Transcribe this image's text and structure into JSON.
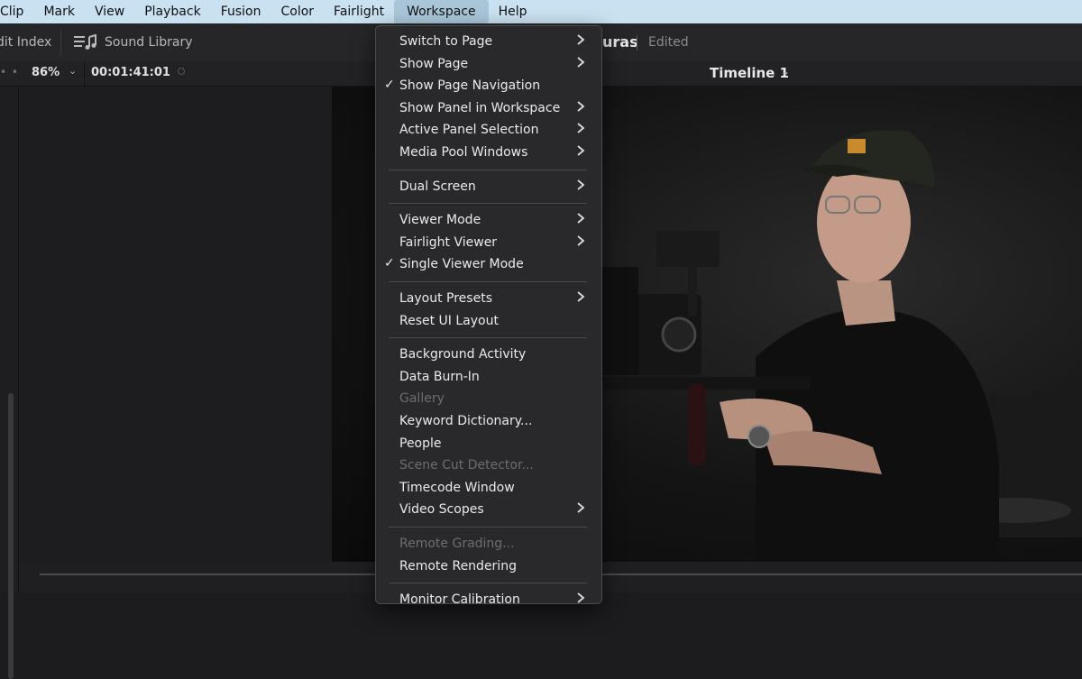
{
  "menubar": {
    "items": [
      "Clip",
      "Mark",
      "View",
      "Playback",
      "Fusion",
      "Color",
      "Fairlight",
      "Workspace",
      "Help"
    ],
    "active": "Workspace"
  },
  "toolbar": {
    "edit_index": "dit Index",
    "sound_library": "Sound Library",
    "project_name": "uras",
    "project_status": "Edited"
  },
  "viewer_header": {
    "zoom": "86%",
    "timecode": "00:01:41:01",
    "timeline_name": "Timeline 1"
  },
  "workspace_menu": {
    "groups": [
      [
        {
          "label": "Switch to Page",
          "submenu": true
        },
        {
          "label": "Show Page",
          "submenu": true
        },
        {
          "label": "Show Page Navigation",
          "checked": true
        },
        {
          "label": "Show Panel in Workspace",
          "submenu": true
        },
        {
          "label": "Active Panel Selection",
          "submenu": true
        },
        {
          "label": "Media Pool Windows",
          "submenu": true
        }
      ],
      [
        {
          "label": "Dual Screen",
          "submenu": true
        }
      ],
      [
        {
          "label": "Viewer Mode",
          "submenu": true
        },
        {
          "label": "Fairlight Viewer",
          "submenu": true
        },
        {
          "label": "Single Viewer Mode",
          "checked": true
        }
      ],
      [
        {
          "label": "Layout Presets",
          "submenu": true
        },
        {
          "label": "Reset UI Layout"
        }
      ],
      [
        {
          "label": "Background Activity"
        },
        {
          "label": "Data Burn-In"
        },
        {
          "label": "Gallery",
          "disabled": true
        },
        {
          "label": "Keyword Dictionary..."
        },
        {
          "label": "People"
        },
        {
          "label": "Scene Cut Detector...",
          "disabled": true
        },
        {
          "label": "Timecode Window"
        },
        {
          "label": "Video Scopes",
          "submenu": true
        }
      ],
      [
        {
          "label": "Remote Grading...",
          "disabled": true
        },
        {
          "label": "Remote Rendering"
        }
      ],
      [
        {
          "label": "Monitor Calibration",
          "submenu": true
        }
      ]
    ]
  }
}
